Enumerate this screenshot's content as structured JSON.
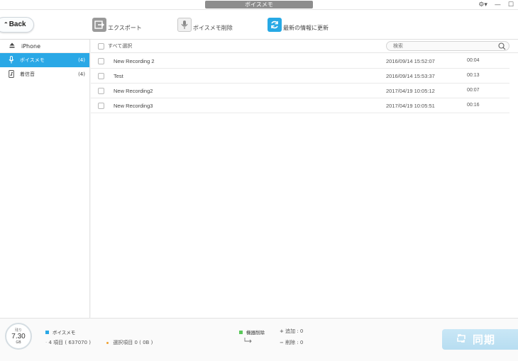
{
  "window": {
    "title": "ボイスメモ"
  },
  "toolbar": {
    "back_label": "Back",
    "export_label": "エクスポート",
    "delete_label": "ボイスメモ削除",
    "refresh_label": "最新の情報に更新"
  },
  "sidebar": {
    "device": "iPhone",
    "items": [
      {
        "label": "ボイスメモ",
        "count": "(4)",
        "icon": "microphone-icon",
        "active": true
      },
      {
        "label": "着信音",
        "count": "(4)",
        "icon": "phone-ringtone-icon",
        "active": false
      }
    ]
  },
  "list": {
    "select_all_label": "すべて選択",
    "search_placeholder": "検索",
    "rows": [
      {
        "name": "New Recording 2",
        "date": "2016/09/14 15:52:07",
        "duration": "00:04"
      },
      {
        "name": "Test",
        "date": "2016/09/14 15:53:37",
        "duration": "00:13"
      },
      {
        "name": "New Recording2",
        "date": "2017/04/19 10:05:12",
        "duration": "00:07"
      },
      {
        "name": "New Recording3",
        "date": "2017/04/19 10:05:51",
        "duration": "00:16"
      }
    ]
  },
  "footer": {
    "storage_label": "残り",
    "storage_value": "7.30",
    "storage_unit": "GB",
    "category_label": "ボイスメモ",
    "items_text": "4 項目 ( 637070 )",
    "selected_text": "選択項目 0 ( 0B )",
    "delete_mode_label": "機器削除",
    "add_text": "追加 : 0",
    "remove_text": "削除 : 0",
    "sync_label": "同期"
  },
  "colors": {
    "accent": "#2aa8e6",
    "category": "#2aa8e6",
    "delete_mode": "#5ac85a",
    "selected_dot": "#f0a030",
    "sync_button": "#bfe2f4"
  }
}
